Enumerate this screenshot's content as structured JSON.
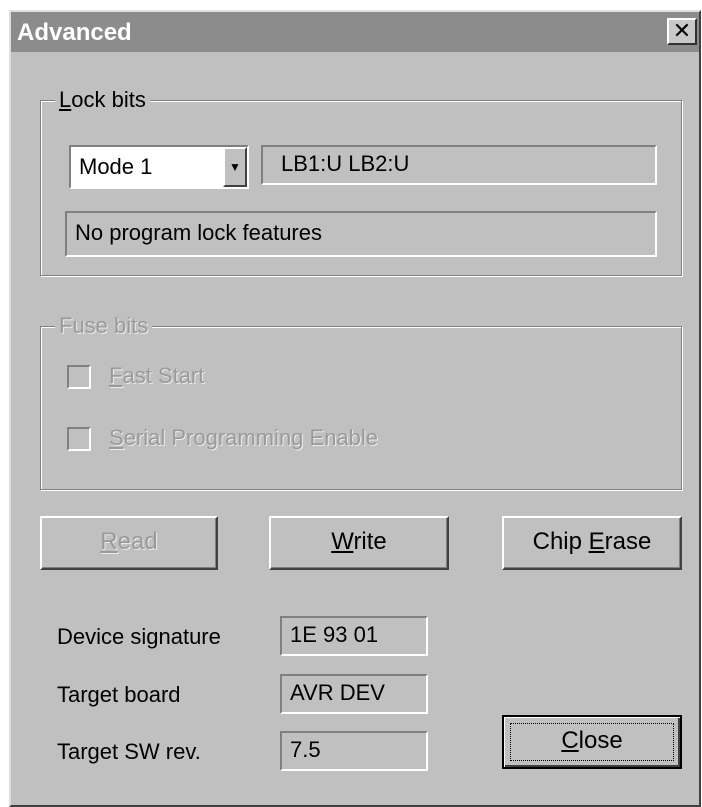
{
  "window": {
    "title": "Advanced",
    "close_glyph": "✕"
  },
  "lock_bits": {
    "legend_prefix": "",
    "legend_accel": "L",
    "legend_rest": "ock bits",
    "mode_select": {
      "value": "Mode 1",
      "arrow": "▼"
    },
    "bits_display": "LB1:U LB2:U",
    "description": "No program lock features"
  },
  "fuse_bits": {
    "legend": "Fuse bits",
    "options": [
      {
        "accel": "F",
        "rest": "ast Start",
        "checked": false,
        "enabled": false
      },
      {
        "accel": "S",
        "rest": "erial Programming Enable",
        "checked": false,
        "enabled": false
      }
    ]
  },
  "buttons": {
    "read": {
      "accel": "R",
      "rest": "ead",
      "enabled": false
    },
    "write": {
      "accel": "W",
      "rest": "rite",
      "enabled": true
    },
    "chip_erase": {
      "pre": "Chip ",
      "accel": "E",
      "rest": "rase",
      "enabled": true
    },
    "close": {
      "accel": "C",
      "rest": "lose",
      "enabled": true
    }
  },
  "info": {
    "device_signature": {
      "label": "Device signature",
      "value": "1E 93 01"
    },
    "target_board": {
      "label": "Target board",
      "value": "AVR DEV"
    },
    "target_sw_rev": {
      "label": "Target SW rev.",
      "value": "7.5"
    }
  }
}
